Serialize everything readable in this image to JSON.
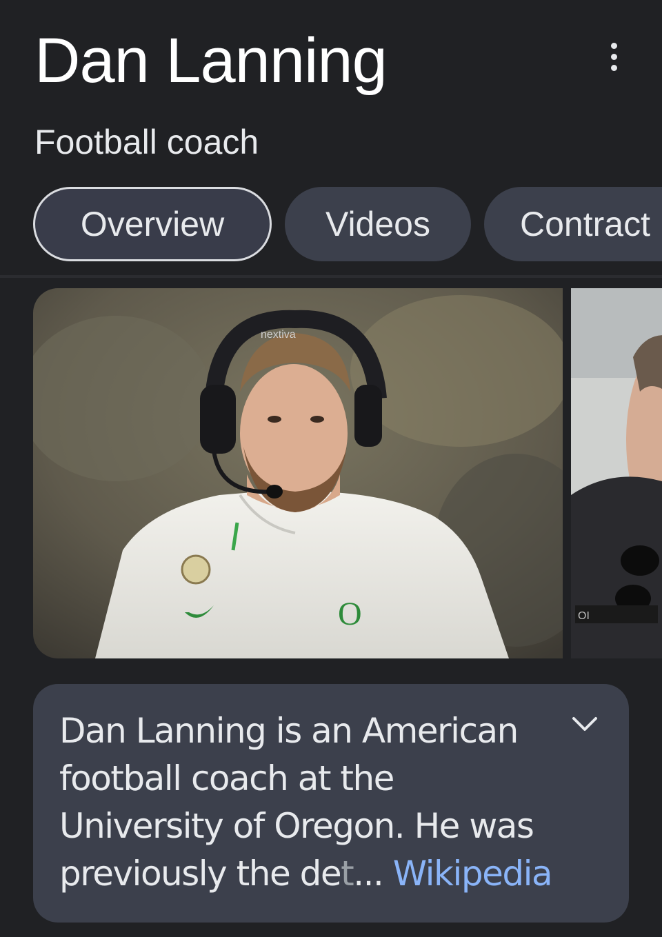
{
  "header": {
    "title": "Dan Lanning",
    "subtitle": "Football coach",
    "more_icon": "more-vert-icon"
  },
  "tabs": [
    {
      "label": "Overview",
      "active": true
    },
    {
      "label": "Videos",
      "active": false
    },
    {
      "label": "Contract",
      "active": false
    }
  ],
  "images": [
    {
      "description": "photo-coach-headset",
      "jersey_logo": "O",
      "headset_brand": "nextiva"
    },
    {
      "description": "photo-coach-sunglasses"
    }
  ],
  "description": {
    "text_main": "Dan Lanning is an American football coach at the University of Oregon. He was previously the de",
    "text_fade": "t",
    "ellipsis": "... ",
    "source": "Wikipedia",
    "expand_icon": "chevron-down-icon"
  },
  "colors": {
    "background": "#202124",
    "chip": "#3c404c",
    "link": "#8ab4f8",
    "text": "#e8eaed"
  }
}
